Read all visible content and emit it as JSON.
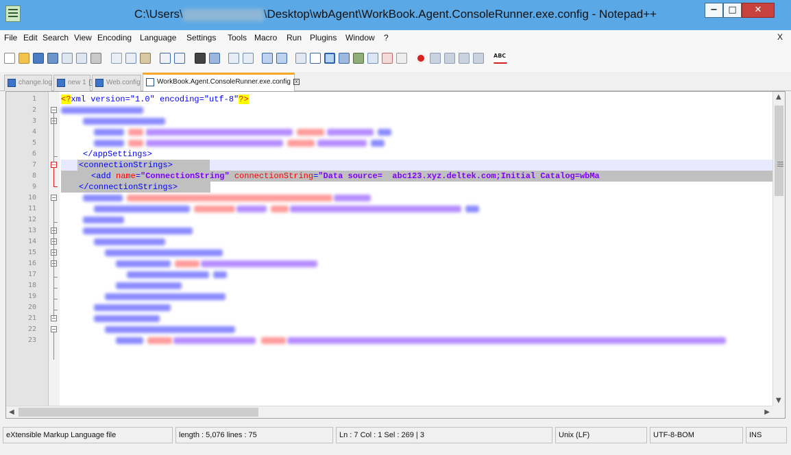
{
  "window": {
    "title_prefix": "C:\\Users\\",
    "title_suffix": "\\Desktop\\wbAgent\\WorkBook.Agent.ConsoleRunner.exe.config - Notepad++",
    "minimize": "−",
    "maximize": "□",
    "close": "✕"
  },
  "menu": {
    "items": [
      "File",
      "Edit",
      "Search",
      "View",
      "Encoding",
      "Language",
      "Settings",
      "Tools",
      "Macro",
      "Run",
      "Plugins",
      "Window",
      "?"
    ],
    "close": "X"
  },
  "tabs": [
    {
      "label": "change.log",
      "active": false
    },
    {
      "label": "new 1",
      "active": false
    },
    {
      "label": "Web.config",
      "active": false
    },
    {
      "label": "WorkBook.Agent.ConsoleRunner.exe.config",
      "active": true
    }
  ],
  "editor": {
    "line_numbers": [
      "1",
      "2",
      "3",
      "4",
      "5",
      "6",
      "7",
      "8",
      "9",
      "10",
      "11",
      "12",
      "13",
      "14",
      "15",
      "16",
      "17",
      "18",
      "19",
      "20",
      "21",
      "22",
      "23"
    ],
    "line1": {
      "pi_open": "<?",
      "rest": "xml version=\"1.0\" encoding=\"utf-8\"",
      "pi_close": "?>"
    },
    "line6": "</appSettings>",
    "line7": "<connectionStrings>",
    "line8": {
      "open": "<add ",
      "attr1": "name",
      "eq1": "=",
      "val1": "\"ConnectionString\"",
      "attr2": "connectionString",
      "eq2": "=",
      "val2": "\"Data source=  abc123.xyz.deltek.com;Initial Catalog=wbMa"
    },
    "line9": "</connectionStrings>",
    "current_line": 7
  },
  "statusbar": {
    "file_type": "eXtensible Markup Language file",
    "length_lines": "length : 5,076    lines : 75",
    "position": "Ln : 7    Col : 1    Sel : 269 | 3",
    "eol": "Unix (LF)",
    "encoding": "UTF-8-BOM",
    "mode": "INS"
  },
  "colors": {
    "title_bar": "#5aa9e6",
    "close_button": "#c7423d",
    "active_tab_accent": "#f5a623",
    "current_line_highlight": "#e8e8ff",
    "selection": "#c0c0c0",
    "xml_tag": "#0000ff",
    "xml_attribute": "#ff0000",
    "xml_value": "#8000ff"
  },
  "icons": [
    "app-icon",
    "new-file-icon",
    "open-file-icon",
    "save-icon",
    "save-all-icon",
    "close-icon",
    "close-all-icon",
    "print-icon",
    "cut-icon",
    "copy-icon",
    "paste-icon",
    "undo-icon",
    "redo-icon",
    "find-icon",
    "replace-icon",
    "zoom-in-icon",
    "zoom-out-icon",
    "sync-vertical-icon",
    "sync-horizontal-icon",
    "word-wrap-icon",
    "show-all-chars-icon",
    "indent-guide-icon",
    "user-language-icon",
    "doc-map-icon",
    "function-list-icon",
    "folder-workspace-icon",
    "monitoring-icon",
    "record-macro-icon",
    "stop-macro-icon",
    "play-macro-icon",
    "run-macro-multiple-icon",
    "save-macro-icon",
    "spell-check-icon"
  ]
}
